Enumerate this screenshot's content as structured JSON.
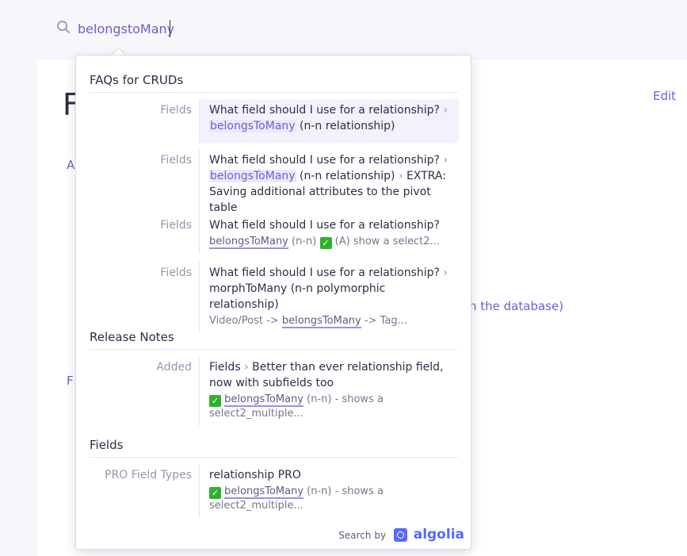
{
  "search": {
    "query": "belongstoMany"
  },
  "background": {
    "title_fragment": "F",
    "edit_label": "Edit",
    "side_fragment_a": "A",
    "side_fragment_f": "F",
    "db_text": "n the database)"
  },
  "dropdown": {
    "categories": {
      "faq": "FAQs for CRUDs",
      "release": "Release Notes",
      "fields": "Fields"
    },
    "hits": [
      {
        "subcategory": "Fields",
        "line1": "What field should I use for a relationship?",
        "hl": "belongsToMany",
        "rest": "(n-n relationship)"
      },
      {
        "subcategory": "Fields",
        "line1": "What field should I use for a relationship?",
        "hl": "belongsToMany",
        "rest": "(n-n relationship)",
        "extra": "EXTRA: Saving additional attributes to the pivot table"
      },
      {
        "subcategory": "Fields",
        "line1": "What field should I use for a relationship?",
        "snippet_u": "belongsToMany",
        "snippet_a": "(n-n)",
        "snippet_b": "(A) show a select2..."
      },
      {
        "subcategory": "Fields",
        "line1": "What field should I use for a relationship?",
        "line2": "morphToMany (n-n polymorphic relationship)",
        "snippet_pre": "Video/Post ->",
        "snippet_u": "belongsToMany",
        "snippet_post": "-> Tag..."
      },
      {
        "subcategory": "Added",
        "line1": "Fields",
        "line1b": "Better than ever relationship field, now with subfields too",
        "snippet_u": "belongsToMany",
        "snippet_post": "(n-n) - shows a select2_multiple..."
      },
      {
        "subcategory": "PRO Field Types",
        "line1": "relationship PRO",
        "snippet_u": "belongsToMany",
        "snippet_post": "(n-n) - shows a select2_multiple..."
      }
    ],
    "footer": {
      "search_by": "Search by",
      "brand": "algolia"
    }
  },
  "colors": {
    "accent": "#6b5fd3",
    "algolia": "#5468ff",
    "check": "#2fb12f"
  },
  "icons": {
    "search": "search-icon",
    "check": "check-icon",
    "algolia": "algolia-logo"
  }
}
